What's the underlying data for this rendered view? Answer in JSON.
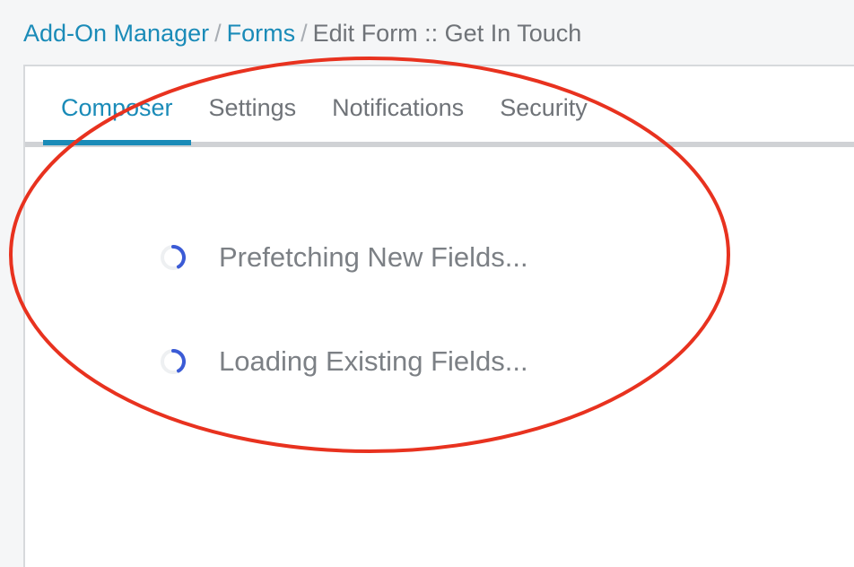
{
  "breadcrumb": {
    "items": [
      {
        "label": "Add-On Manager",
        "link": true
      },
      {
        "label": "Forms",
        "link": true
      },
      {
        "label": "Edit Form :: Get In Touch",
        "link": false
      }
    ],
    "separator": "/"
  },
  "tabs": [
    {
      "label": "Composer",
      "active": true
    },
    {
      "label": "Settings",
      "active": false
    },
    {
      "label": "Notifications",
      "active": false
    },
    {
      "label": "Security",
      "active": false
    }
  ],
  "loaders": [
    {
      "text": "Prefetching New Fields...",
      "icon": "spinner-icon"
    },
    {
      "text": "Loading Existing Fields...",
      "icon": "spinner-icon"
    }
  ],
  "colors": {
    "accent": "#1a8bb8",
    "spinner": "#3b5bd6",
    "annotation": "#e8321f"
  }
}
